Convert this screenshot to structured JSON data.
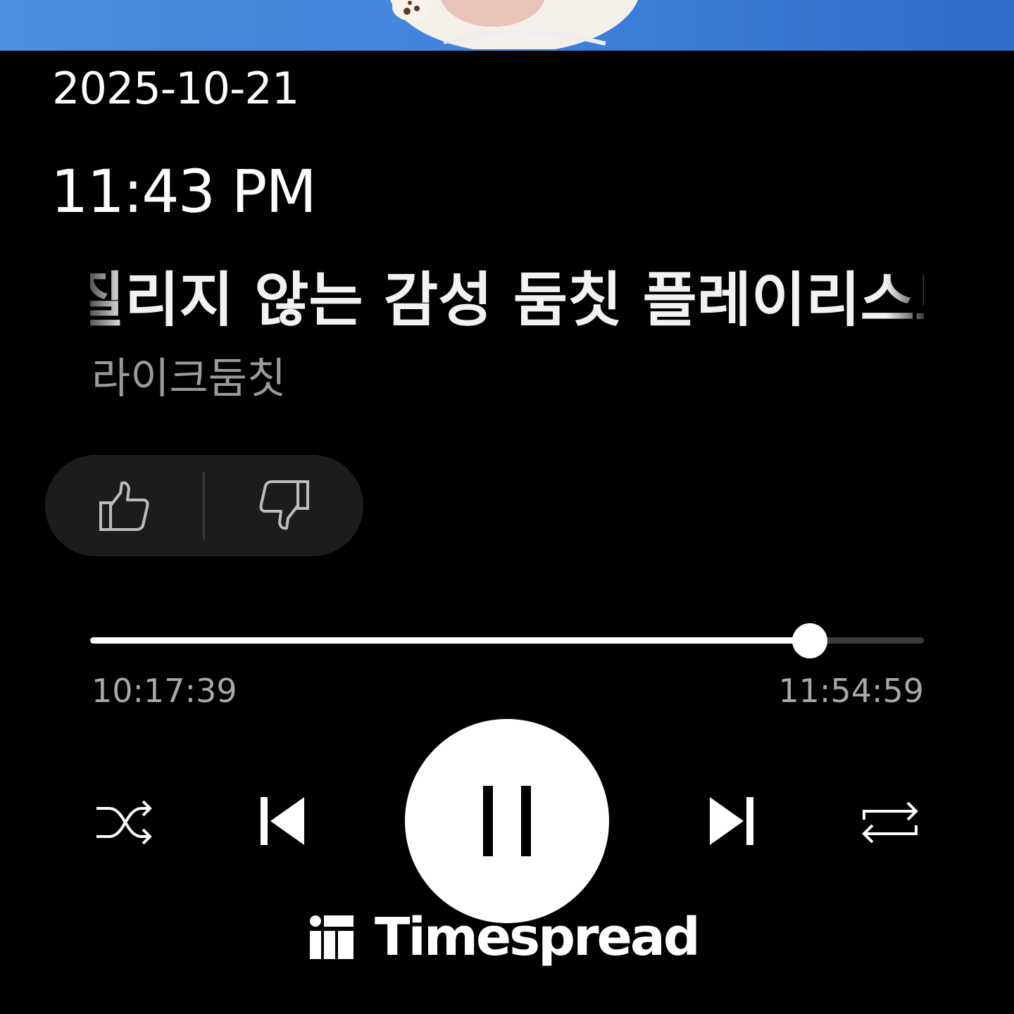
{
  "status": {
    "date": "2025-10-21",
    "time": "11:43 PM"
  },
  "track": {
    "title": "질리지 않는 감성 둠칫 플레이리스트",
    "artist": "라이크둠칫"
  },
  "rating": {
    "like_icon": "thumbs-up-icon",
    "dislike_icon": "thumbs-down-icon"
  },
  "playback": {
    "elapsed": "10:17:39",
    "total": "11:54:59",
    "progress_fraction": 0.863,
    "state": "playing"
  },
  "controls": {
    "shuffle_icon": "shuffle-icon",
    "previous_icon": "skip-previous-icon",
    "play_pause_icon": "pause-icon",
    "next_icon": "skip-next-icon",
    "repeat_icon": "repeat-icon"
  },
  "watermark": {
    "brand": "Timespread",
    "logo_icon": "timespread-logo-icon"
  },
  "colors": {
    "background": "#000000",
    "banner": "#3f83dc",
    "foreground": "#ffffff",
    "secondary_text": "#9a9a9a",
    "pill": "#1c1c1c",
    "track_remaining": "#3c3c3c"
  }
}
